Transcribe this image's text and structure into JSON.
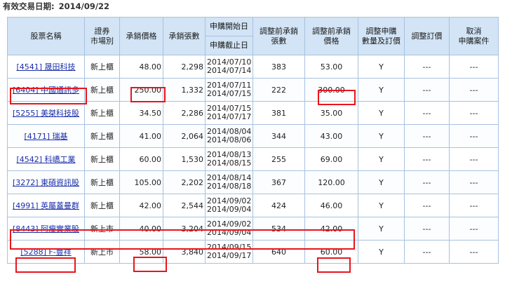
{
  "header": {
    "label": "有效交易日期:",
    "date": "2014/09/22"
  },
  "columns": {
    "stock_name": "股票名稱",
    "market_line1": "證券",
    "market_line2": "市場別",
    "price": "承銷價格",
    "shares": "承銷張數",
    "start": "申購開始日",
    "end": "申購截止日",
    "adj_shares_line1": "調整前承銷",
    "adj_shares_line2": "張數",
    "adj_price_line1": "調整前承銷",
    "adj_price_line2": "價格",
    "adjust_line1": "調整申購",
    "adjust_line2": "數量及訂價",
    "set_price": "調整訂價",
    "cancel_line1": "取消",
    "cancel_line2": "申購案件"
  },
  "rows": [
    {
      "code": "[4541]",
      "name": "晟田科技",
      "market": "新上櫃",
      "price": "48.00",
      "shares": "2,298",
      "start": "2014/07/10",
      "end": "2014/07/14",
      "pre_shares": "383",
      "pre_price": "53.00",
      "adjust": "Y",
      "set_price": "---",
      "cancel": "---"
    },
    {
      "code": "[6404]",
      "name": "中國通訊多",
      "market": "新上櫃",
      "price": "250.00",
      "shares": "1,332",
      "start": "2014/07/11",
      "end": "2014/07/15",
      "pre_shares": "222",
      "pre_price": "300.00",
      "adjust": "Y",
      "set_price": "---",
      "cancel": "---"
    },
    {
      "code": "[5255]",
      "name": "美桀科技股",
      "market": "新上櫃",
      "price": "34.50",
      "shares": "2,286",
      "start": "2014/07/15",
      "end": "2014/07/17",
      "pre_shares": "381",
      "pre_price": "35.00",
      "adjust": "Y",
      "set_price": "---",
      "cancel": "---"
    },
    {
      "code": "[4171]",
      "name": "瑞基",
      "market": "新上櫃",
      "price": "41.00",
      "shares": "2,064",
      "start": "2014/08/04",
      "end": "2014/08/06",
      "pre_shares": "344",
      "pre_price": "43.00",
      "adjust": "Y",
      "set_price": "---",
      "cancel": "---"
    },
    {
      "code": "[4542]",
      "name": "科嶠工業",
      "market": "新上櫃",
      "price": "60.00",
      "shares": "1,530",
      "start": "2014/08/13",
      "end": "2014/08/15",
      "pre_shares": "255",
      "pre_price": "69.00",
      "adjust": "Y",
      "set_price": "---",
      "cancel": "---"
    },
    {
      "code": "[3272]",
      "name": "東碩資訊股",
      "market": "新上櫃",
      "price": "105.00",
      "shares": "2,202",
      "start": "2014/08/14",
      "end": "2014/08/18",
      "pre_shares": "367",
      "pre_price": "120.00",
      "adjust": "Y",
      "set_price": "---",
      "cancel": "---"
    },
    {
      "code": "[4991]",
      "name": "英屬蓋曼群",
      "market": "新上櫃",
      "price": "42.00",
      "shares": "2,544",
      "start": "2014/09/02",
      "end": "2014/09/04",
      "pre_shares": "424",
      "pre_price": "46.00",
      "adjust": "Y",
      "set_price": "---",
      "cancel": "---"
    },
    {
      "code": "[8443]",
      "name": "阿瘦實業股",
      "market": "新上市",
      "price": "40.00",
      "shares": "3,204",
      "start": "2014/09/02",
      "end": "2014/09/04",
      "pre_shares": "534",
      "pre_price": "42.00",
      "adjust": "Y",
      "set_price": "---",
      "cancel": "---"
    },
    {
      "code": "[5288]",
      "name": "F-豐祥",
      "market": "新上市",
      "price": "58.00",
      "shares": "3,840",
      "start": "2014/09/15",
      "end": "2014/09/17",
      "pre_shares": "640",
      "pre_price": "60.00",
      "adjust": "Y",
      "set_price": "---",
      "cancel": "---"
    }
  ],
  "colors": {
    "header_bg": "#d2e4f5",
    "border": "#a7c2df",
    "link": "#1a2eaa",
    "highlight": "#e8151c"
  }
}
